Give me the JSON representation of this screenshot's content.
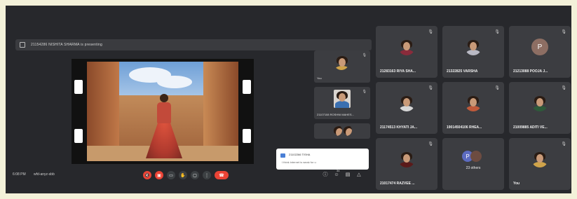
{
  "presentation": {
    "banner_text": "21154286 NISHITA SHARMA is presenting"
  },
  "meeting": {
    "time": "6:08 PM",
    "code": "wfd-anyz-sbb"
  },
  "controls": {
    "right_badge": "34"
  },
  "side_tiles": [
    {
      "name": "You"
    },
    {
      "name": "21107108 ROSHNI MAHES..."
    },
    {
      "name": ""
    }
  ],
  "chat": {
    "sender": "21102266 TISHA",
    "message": "I think internet is weak for u"
  },
  "participants": [
    {
      "name": "21283163 RIYA SHA...",
      "type": "photo",
      "shirt": "#8a2b3b"
    },
    {
      "name": "21322825 VARSHA",
      "type": "photo",
      "shirt": "#b9b9c4"
    },
    {
      "name": "21213088 POOJA J...",
      "type": "letter",
      "letter": "P",
      "color": "#8d6e63"
    },
    {
      "name": "21174513 KHYATI JA...",
      "type": "photo",
      "shirt": "#d7d7d7"
    },
    {
      "name": "19014504106 RHEA...",
      "type": "photo",
      "shirt": "#c05a3a"
    },
    {
      "name": "21009885 ADITI VE...",
      "type": "photo",
      "shirt": "#2e5a3a"
    },
    {
      "name": "21017474 RAZVEE ...",
      "type": "photo",
      "shirt": "#5a1a1a"
    },
    {
      "name": "23 others",
      "type": "others",
      "letter": "P"
    },
    {
      "name": "You",
      "type": "photo",
      "shirt": "#cfa34a"
    }
  ],
  "colors": {
    "background": "#27282c",
    "tile": "#3c3d41",
    "end_call": "#ea4335"
  }
}
